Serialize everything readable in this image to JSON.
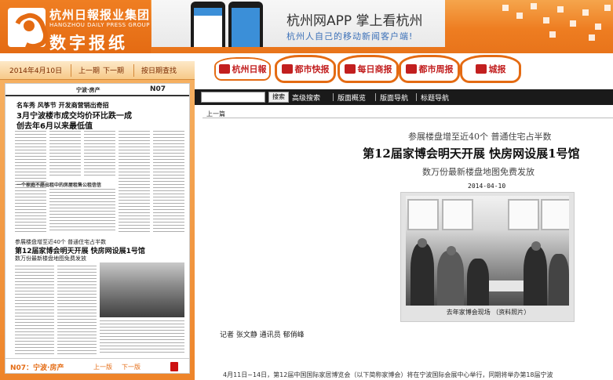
{
  "header": {
    "logo_cn": "杭州日報报业集团",
    "logo_en": "HANGZHOU DAILY PRESS GROUP",
    "logo_digital": "数字报纸",
    "banner_title": "杭州网APP 掌上看杭州",
    "banner_subtitle": "杭州人自己的移动新闻客户端!",
    "brand_color": "#e8741b"
  },
  "toolbar": {
    "date": "2014年4月10日",
    "prev_issue": "上一期",
    "next_issue": "下一期",
    "by_date": "按日期查找"
  },
  "paper_tabs": [
    {
      "label": "杭州日報",
      "icon": "hangzhou-daily-logo"
    },
    {
      "label": "都市快报",
      "icon": "dushi-kuaibao-logo"
    },
    {
      "label": "每日商报",
      "icon": "meiri-shangbao-logo"
    },
    {
      "label": "都市周报",
      "icon": "dushi-zhoubao-logo"
    },
    {
      "label": "城报",
      "icon": "metro-logo"
    }
  ],
  "nav": {
    "search_placeholder": "",
    "search_button": "搜索",
    "advanced_search": "高级搜索",
    "layout_overview": "版面概览",
    "layout_nav": "版面导航",
    "title_nav": "标题导航"
  },
  "newspaper_page": {
    "section": "宁波·房产",
    "page_code": "N07",
    "headline_kicker": "名车秀 风筝节 开发商营销出奇招",
    "headline_line1": "3月宁波楼市成交均价环比跌一成",
    "headline_line2": "创去年6月以来最低值",
    "mid_title": "一个家庭不愿出租中的房屋租售公租信信",
    "article2_kicker": "参展楼盘增至近40个 普通住宅占半数",
    "article2_title": "第12届家博会明天开展 快房网设展1号馆",
    "article2_sub": "数万份最新楼盘地图免费发放",
    "footer_page": "N07：宁波·房产",
    "footer_prev": "上一版",
    "footer_next": "下一版"
  },
  "article": {
    "prev_link": "上一篇",
    "pretitle": "参展楼盘增至近40个 普通住宅占半数",
    "title": "第12届家博会明天开展 快房网设展1号馆",
    "subtitle": "数万份最新楼盘地图免费发放",
    "date": "2014-04-10",
    "photo_caption": "去年家博会现场 （资料照片）",
    "byline": "记者 张文静 通讯员 郁俏峰",
    "body_start": "4月11日~14日，第12届中国国际家居博览会（以下简称家博会）将在宁波国际会展中心举行，同期将举办第18届宁波"
  }
}
